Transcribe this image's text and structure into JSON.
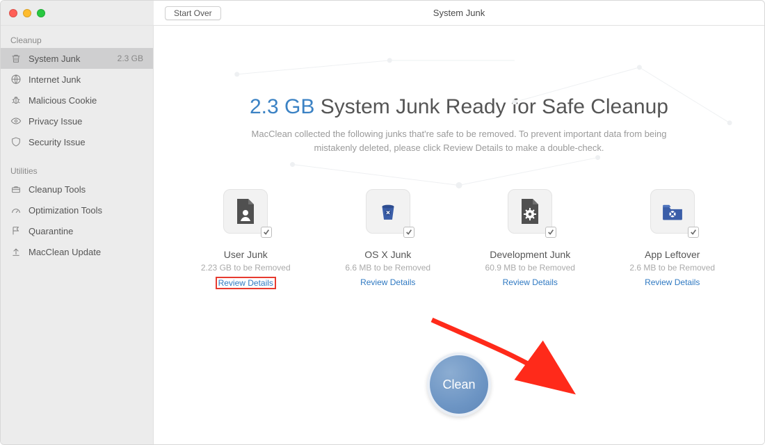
{
  "window": {
    "title": "System Junk"
  },
  "toolbar": {
    "start_over": "Start Over"
  },
  "sidebar": {
    "sections": [
      {
        "label": "Cleanup",
        "items": [
          {
            "icon": "trash-icon",
            "label": "System Junk",
            "badge": "2.3 GB",
            "active": true
          },
          {
            "icon": "globe-icon",
            "label": "Internet Junk"
          },
          {
            "icon": "bug-icon",
            "label": "Malicious Cookie"
          },
          {
            "icon": "eye-icon",
            "label": "Privacy Issue"
          },
          {
            "icon": "shield-icon",
            "label": "Security Issue"
          }
        ]
      },
      {
        "label": "Utilities",
        "items": [
          {
            "icon": "toolbox-icon",
            "label": "Cleanup Tools"
          },
          {
            "icon": "gauge-icon",
            "label": "Optimization Tools"
          },
          {
            "icon": "flag-icon",
            "label": "Quarantine"
          },
          {
            "icon": "upload-icon",
            "label": "MacClean Update"
          }
        ]
      }
    ]
  },
  "headline": {
    "accent": "2.3 GB",
    "rest": " System Junk Ready for Safe Cleanup"
  },
  "subhead": "MacClean collected the following junks that're safe to be removed. To prevent important data from being mistakenly deleted, please click Review Details to make a double-check.",
  "categories": [
    {
      "key": "user",
      "title": "User Junk",
      "sub": "2.23 GB to be Removed",
      "review": "Review Details",
      "highlight": true
    },
    {
      "key": "osx",
      "title": "OS X Junk",
      "sub": "6.6 MB to be Removed",
      "review": "Review Details"
    },
    {
      "key": "dev",
      "title": "Development Junk",
      "sub": "60.9 MB to be Removed",
      "review": "Review Details"
    },
    {
      "key": "app",
      "title": "App Leftover",
      "sub": "2.6 MB to be Removed",
      "review": "Review Details"
    }
  ],
  "clean_button": "Clean",
  "colors": {
    "accent": "#3b82c4",
    "arrow": "#ff2a1a"
  }
}
